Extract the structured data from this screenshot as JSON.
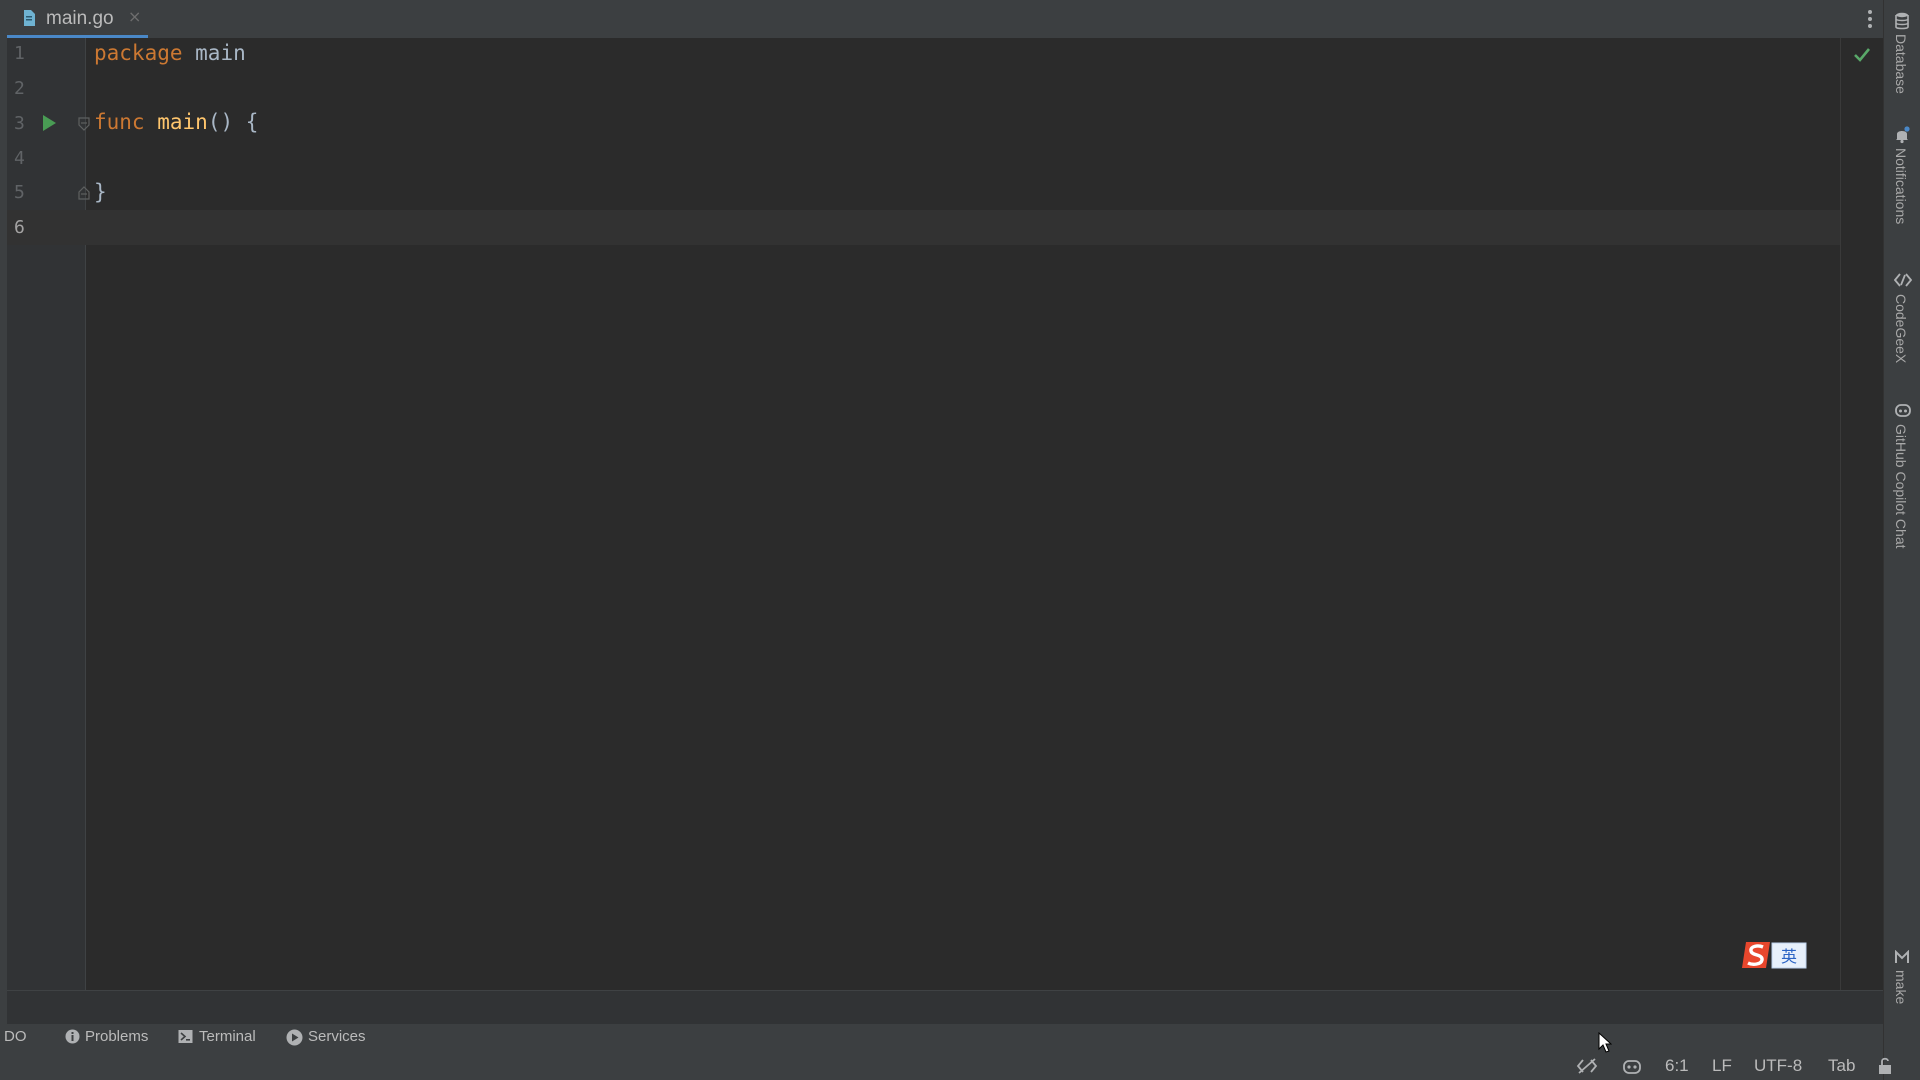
{
  "editor": {
    "tab": {
      "filename": "main.go",
      "close": "×"
    },
    "lines": [
      {
        "num": "1",
        "kw": "package",
        "rest": " main",
        "fn": "",
        "tail": ""
      },
      {
        "num": "2",
        "kw": "",
        "rest": "",
        "fn": "",
        "tail": ""
      },
      {
        "num": "3",
        "kw": "func",
        "rest": " ",
        "fn": "main",
        "tail": "() {"
      },
      {
        "num": "4",
        "kw": "",
        "rest": "",
        "fn": "",
        "tail": ""
      },
      {
        "num": "5",
        "kw": "",
        "rest": "",
        "fn": "",
        "tail": "}"
      },
      {
        "num": "6",
        "kw": "",
        "rest": "",
        "fn": "",
        "tail": ""
      }
    ],
    "caret": {
      "line": 6,
      "column": 1
    }
  },
  "right_tools": [
    {
      "label": "Database",
      "icon": "database-icon"
    },
    {
      "label": "Notifications",
      "icon": "bell-icon"
    },
    {
      "label": "CodeGeeX",
      "icon": "codegeex-icon"
    },
    {
      "label": "GitHub Copilot Chat",
      "icon": "copilot-icon"
    },
    {
      "label": "make",
      "icon": "make-icon"
    }
  ],
  "bottom_tools": [
    {
      "label": "DO",
      "icon": ""
    },
    {
      "label": "Problems",
      "icon": "info-icon"
    },
    {
      "label": "Terminal",
      "icon": "terminal-icon"
    },
    {
      "label": "Services",
      "icon": "services-icon"
    }
  ],
  "status": {
    "position": "6:1",
    "line_separator": "LF",
    "encoding": "UTF-8",
    "indent": "Tab"
  },
  "ime": {
    "label": "英"
  },
  "colors": {
    "keyword": "#cc7832",
    "function": "#ffc66d",
    "text": "#a9b7c6",
    "accent": "#4a88c7",
    "ok": "#59a869"
  }
}
